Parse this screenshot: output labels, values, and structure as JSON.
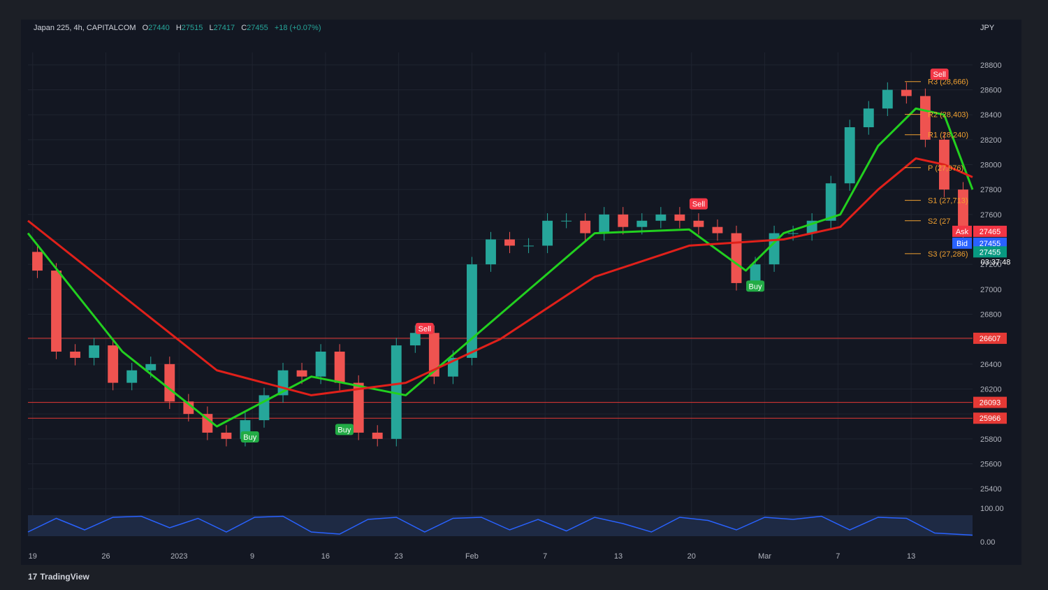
{
  "header": {
    "symbol": "Japan 225, 4h, CAPITALCOM",
    "open_label": "O",
    "open": "27440",
    "high_label": "H",
    "high": "27515",
    "low_label": "L",
    "low": "27417",
    "close_label": "C",
    "close": "27455",
    "change": "+18 (+0.07%)",
    "currency": "JPY"
  },
  "footer": {
    "brand": "TradingView"
  },
  "colors": {
    "background": "#131722",
    "up": "#26a69a",
    "down": "#ef5350",
    "ema_green": "#22d01f",
    "ema_red": "#e0201a",
    "pivot": "#f0a030",
    "level_line": "#e53935"
  },
  "chart_data": [
    {
      "type": "line",
      "title": "Japan 225, 4h, CAPITALCOM",
      "ylim": [
        25300,
        28900
      ],
      "y_ticks": [
        25400,
        25600,
        25800,
        26000,
        26200,
        26400,
        26600,
        26800,
        27000,
        27200,
        27400,
        27600,
        27800,
        28000,
        28200,
        28400,
        28600,
        28800
      ],
      "y_tick_labels": [
        "25400",
        "25600",
        "25800",
        "",
        "26200",
        "26400",
        "",
        "26800",
        "27000",
        "27200",
        "",
        "27600",
        "27800",
        "28000",
        "28200",
        "28400",
        "28600",
        "28800"
      ],
      "x_tick_labels": [
        "19",
        "26",
        "2023",
        "9",
        "16",
        "23",
        "Feb",
        "7",
        "13",
        "20",
        "Mar",
        "7",
        "13"
      ],
      "price_path": {
        "x": [
          0,
          2,
          4,
          6,
          8,
          10,
          12,
          14,
          16,
          18,
          20,
          22,
          24,
          26,
          28,
          30,
          32,
          34,
          36,
          38,
          40,
          42,
          44,
          46,
          48,
          50,
          52,
          54,
          56,
          58,
          60,
          62,
          64,
          66,
          68,
          70,
          72,
          74,
          76,
          78,
          80,
          82,
          84,
          86,
          88,
          90,
          92,
          94,
          96,
          98,
          100
        ],
        "close": [
          27300,
          27150,
          26500,
          26450,
          26550,
          26250,
          26350,
          26400,
          26100,
          26000,
          25850,
          25800,
          25950,
          26150,
          26350,
          26300,
          26500,
          26250,
          25850,
          25800,
          26550,
          26650,
          26300,
          26450,
          27200,
          27400,
          27350,
          27350,
          27550,
          27550,
          27450,
          27600,
          27500,
          27550,
          27600,
          27550,
          27500,
          27450,
          27050,
          27200,
          27450,
          27450,
          27550,
          27850,
          28300,
          28450,
          28600,
          28550,
          28200,
          27800,
          27455
        ]
      },
      "series": [
        {
          "name": "",
          "kind": "ema_fast",
          "x": [
            0,
            10,
            20,
            30,
            40,
            50,
            60,
            70,
            76,
            80,
            86,
            90,
            94,
            97,
            100
          ],
          "values": [
            27450,
            26500,
            25900,
            26300,
            26150,
            26800,
            27450,
            27480,
            27150,
            27450,
            27600,
            28150,
            28450,
            28400,
            27800
          ]
        },
        {
          "name": "",
          "kind": "ema_slow",
          "x": [
            0,
            10,
            20,
            30,
            40,
            50,
            60,
            70,
            76,
            80,
            86,
            90,
            94,
            97,
            100
          ],
          "values": [
            27550,
            26950,
            26350,
            26150,
            26250,
            26600,
            27100,
            27350,
            27380,
            27400,
            27500,
            27800,
            28050,
            28000,
            27900
          ]
        }
      ],
      "horizontal_levels": [
        {
          "label": "26607",
          "value": 26607,
          "color": "#e53935"
        },
        {
          "label": "26093",
          "value": 26093,
          "color": "#e53935"
        },
        {
          "label": "25966",
          "value": 25966,
          "color": "#e53935"
        }
      ],
      "pivots": [
        {
          "label": "R3 (28,666)",
          "value": 28666
        },
        {
          "label": "R2 (28,403)",
          "value": 28403
        },
        {
          "label": "R1 (28,240)",
          "value": 28240
        },
        {
          "label": "P (27,976)",
          "value": 27976
        },
        {
          "label": "S1 (27,713)",
          "value": 27713
        },
        {
          "label": "S2 (27",
          "value": 27550
        },
        {
          "label": "S3 (27,286)",
          "value": 27286
        }
      ],
      "signals": [
        {
          "label": "Sell",
          "x": 42,
          "value": 26680,
          "type": "sell"
        },
        {
          "label": "Buy",
          "x": 23.5,
          "value": 25810,
          "type": "buy"
        },
        {
          "label": "Buy",
          "x": 33.5,
          "value": 25870,
          "type": "buy"
        },
        {
          "label": "Sell",
          "x": 71,
          "value": 27680,
          "type": "sell"
        },
        {
          "label": "Buy",
          "x": 77,
          "value": 27020,
          "type": "buy"
        },
        {
          "label": "Sell",
          "x": 96.5,
          "value": 28720,
          "type": "sell"
        }
      ],
      "price_tags": [
        {
          "label": "Ask",
          "value": "27465",
          "price": 27465,
          "color": "#f23645"
        },
        {
          "label": "Bid",
          "value": "27455",
          "price": 27370,
          "color": "#2962ff"
        },
        {
          "label": "",
          "value": "27455",
          "price": 27300,
          "color": "#089981"
        }
      ],
      "countdown": "03:37:48"
    },
    {
      "type": "line",
      "title": "",
      "ylim": [
        0,
        100
      ],
      "y_tick_labels": [
        "100.00",
        "0.00"
      ],
      "series": [
        {
          "name": "",
          "x": [
            0,
            3,
            6,
            9,
            12,
            15,
            18,
            21,
            24,
            27,
            30,
            33,
            36,
            39,
            42,
            45,
            48,
            51,
            54,
            57,
            60,
            63,
            66,
            69,
            72,
            75,
            78,
            81,
            84,
            87,
            90,
            93,
            96,
            100
          ],
          "values": [
            20,
            85,
            30,
            90,
            95,
            40,
            85,
            20,
            90,
            95,
            20,
            10,
            80,
            90,
            20,
            85,
            90,
            30,
            80,
            25,
            90,
            60,
            20,
            90,
            75,
            30,
            90,
            80,
            95,
            30,
            90,
            85,
            15,
            5
          ]
        }
      ]
    }
  ]
}
